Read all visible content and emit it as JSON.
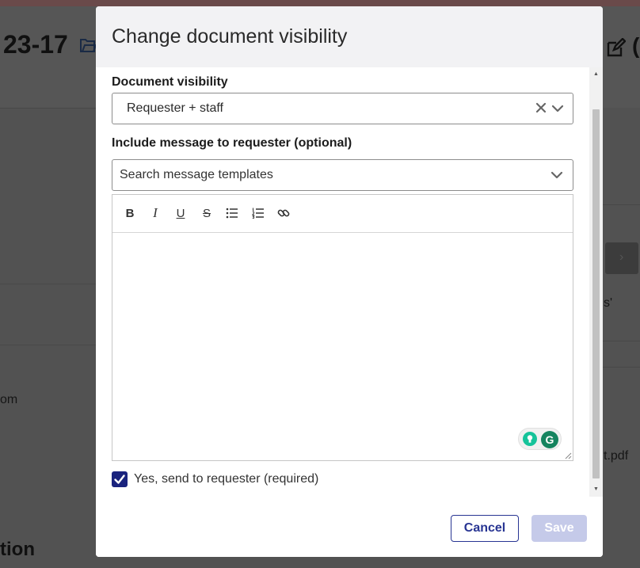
{
  "background": {
    "title_fragment": "23-17",
    "text_fragment_1": "om",
    "text_fragment_2": "s'",
    "text_fragment_3": "t.pdf",
    "section_fragment": "tion"
  },
  "modal": {
    "title": "Change document visibility",
    "visibility": {
      "label": "Document visibility",
      "selected_value": "Requester + staff"
    },
    "message": {
      "label": "Include message to requester (optional)",
      "template_placeholder": "Search message templates"
    },
    "toolbar": {
      "bold_glyph": "B",
      "italic_glyph": "I",
      "underline_glyph": "U",
      "strike_glyph": "S"
    },
    "grammarly_glyph": "G",
    "send_checkbox": {
      "label": "Yes, send to requester (required)",
      "checked": true
    },
    "footer": {
      "cancel_label": "Cancel",
      "save_label": "Save"
    }
  },
  "colors": {
    "primary": "#283593",
    "checkbox": "#1a237e",
    "save_disabled": "#c5cae9",
    "grammarly": "#15845f"
  }
}
